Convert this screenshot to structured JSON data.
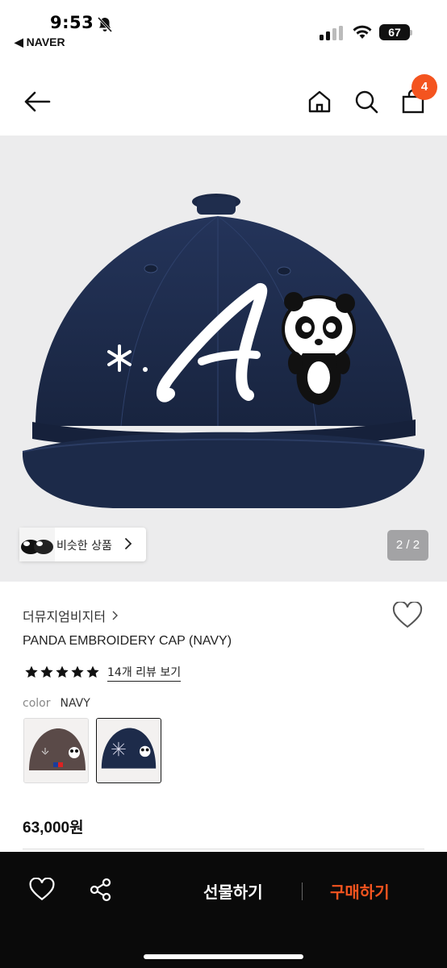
{
  "status_bar": {
    "time": "9:53",
    "back_app": "◀ NAVER",
    "battery": "67"
  },
  "nav": {
    "cart_count": "4",
    "icons": [
      "back-arrow-icon",
      "home-icon",
      "search-icon",
      "cart-icon"
    ]
  },
  "hero": {
    "similar_label": "비슷한 상품",
    "page_indicator": "2 / 2"
  },
  "product": {
    "brand": "더뮤지엄비지터",
    "title": "PANDA EMBROIDERY CAP (NAVY)",
    "rating": 5,
    "review_link": "14개 리뷰 보기",
    "color_label": "color",
    "color_value": "NAVY",
    "options": [
      "brown",
      "navy"
    ],
    "price": "63,000원"
  },
  "bottom_bar": {
    "gift_label": "선물하기",
    "buy_label": "구매하기"
  },
  "colors": {
    "accent": "#f4541f",
    "navy_cap": "#1d2b4a",
    "brown_cap": "#5a4a48"
  }
}
